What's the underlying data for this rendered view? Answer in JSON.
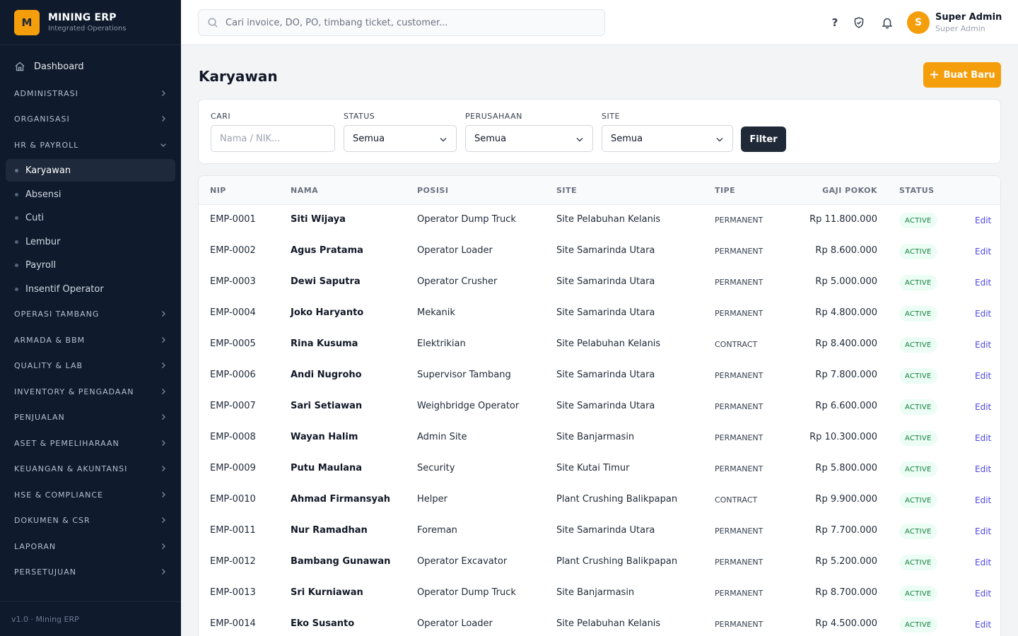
{
  "brand": {
    "logo_letter": "M",
    "name": "MINING ERP",
    "subtitle": "Integrated Operations"
  },
  "sidebar": {
    "dashboard_label": "Dashboard",
    "sections": [
      {
        "label": "ADMINISTRASI",
        "expanded": false
      },
      {
        "label": "ORGANISASI",
        "expanded": false
      },
      {
        "label": "HR & PAYROLL",
        "expanded": true
      },
      {
        "label": "OPERASI TAMBANG",
        "expanded": false
      },
      {
        "label": "ARMADA & BBM",
        "expanded": false
      },
      {
        "label": "QUALITY & LAB",
        "expanded": false
      },
      {
        "label": "INVENTORY & PENGADAAN",
        "expanded": false
      },
      {
        "label": "PENJUALAN",
        "expanded": false
      },
      {
        "label": "ASET & PEMELIHARAAN",
        "expanded": false
      },
      {
        "label": "KEUANGAN & AKUNTANSI",
        "expanded": false
      },
      {
        "label": "HSE & COMPLIANCE",
        "expanded": false
      },
      {
        "label": "DOKUMEN & CSR",
        "expanded": false
      },
      {
        "label": "LAPORAN",
        "expanded": false
      },
      {
        "label": "PERSETUJUAN",
        "expanded": false
      }
    ],
    "hr_items": [
      {
        "label": "Karyawan",
        "active": true
      },
      {
        "label": "Absensi",
        "active": false
      },
      {
        "label": "Cuti",
        "active": false
      },
      {
        "label": "Lembur",
        "active": false
      },
      {
        "label": "Payroll",
        "active": false
      },
      {
        "label": "Insentif Operator",
        "active": false
      }
    ],
    "footer": "v1.0 · Mining ERP"
  },
  "topbar": {
    "search_placeholder": "Cari invoice, DO, PO, timbang ticket, customer...",
    "help_glyph": "?",
    "user": {
      "initial": "S",
      "name": "Super Admin",
      "role": "Super Admin"
    }
  },
  "page": {
    "title": "Karyawan",
    "new_button": "Buat Baru",
    "new_button_glyph": "+"
  },
  "filters": {
    "search": {
      "label": "CARI",
      "placeholder": "Nama / NIK..."
    },
    "status": {
      "label": "STATUS",
      "value": "Semua"
    },
    "company": {
      "label": "PERUSAHAAN",
      "value": "Semua"
    },
    "site": {
      "label": "SITE",
      "value": "Semua"
    },
    "submit": "Filter"
  },
  "table": {
    "columns": {
      "nip": "NIP",
      "nama": "NAMA",
      "posisi": "POSISI",
      "site": "SITE",
      "tipe": "TIPE",
      "gaji": "GAJI POKOK",
      "status": "STATUS"
    },
    "edit_label": "Edit",
    "rows": [
      {
        "nip": "EMP-0001",
        "nama": "Siti Wijaya",
        "posisi": "Operator Dump Truck",
        "site": "Site Pelabuhan Kelanis",
        "tipe": "PERMANENT",
        "gaji": "Rp 11.800.000",
        "status": "ACTIVE"
      },
      {
        "nip": "EMP-0002",
        "nama": "Agus Pratama",
        "posisi": "Operator Loader",
        "site": "Site Samarinda Utara",
        "tipe": "PERMANENT",
        "gaji": "Rp 8.600.000",
        "status": "ACTIVE"
      },
      {
        "nip": "EMP-0003",
        "nama": "Dewi Saputra",
        "posisi": "Operator Crusher",
        "site": "Site Samarinda Utara",
        "tipe": "PERMANENT",
        "gaji": "Rp 5.000.000",
        "status": "ACTIVE"
      },
      {
        "nip": "EMP-0004",
        "nama": "Joko Haryanto",
        "posisi": "Mekanik",
        "site": "Site Samarinda Utara",
        "tipe": "PERMANENT",
        "gaji": "Rp 4.800.000",
        "status": "ACTIVE"
      },
      {
        "nip": "EMP-0005",
        "nama": "Rina Kusuma",
        "posisi": "Elektrikian",
        "site": "Site Pelabuhan Kelanis",
        "tipe": "CONTRACT",
        "gaji": "Rp 8.400.000",
        "status": "ACTIVE"
      },
      {
        "nip": "EMP-0006",
        "nama": "Andi Nugroho",
        "posisi": "Supervisor Tambang",
        "site": "Site Samarinda Utara",
        "tipe": "PERMANENT",
        "gaji": "Rp 7.800.000",
        "status": "ACTIVE"
      },
      {
        "nip": "EMP-0007",
        "nama": "Sari Setiawan",
        "posisi": "Weighbridge Operator",
        "site": "Site Samarinda Utara",
        "tipe": "PERMANENT",
        "gaji": "Rp 6.600.000",
        "status": "ACTIVE"
      },
      {
        "nip": "EMP-0008",
        "nama": "Wayan Halim",
        "posisi": "Admin Site",
        "site": "Site Banjarmasin",
        "tipe": "PERMANENT",
        "gaji": "Rp 10.300.000",
        "status": "ACTIVE"
      },
      {
        "nip": "EMP-0009",
        "nama": "Putu Maulana",
        "posisi": "Security",
        "site": "Site Kutai Timur",
        "tipe": "PERMANENT",
        "gaji": "Rp 5.800.000",
        "status": "ACTIVE"
      },
      {
        "nip": "EMP-0010",
        "nama": "Ahmad Firmansyah",
        "posisi": "Helper",
        "site": "Plant Crushing Balikpapan",
        "tipe": "CONTRACT",
        "gaji": "Rp 9.900.000",
        "status": "ACTIVE"
      },
      {
        "nip": "EMP-0011",
        "nama": "Nur Ramadhan",
        "posisi": "Foreman",
        "site": "Site Samarinda Utara",
        "tipe": "PERMANENT",
        "gaji": "Rp 7.700.000",
        "status": "ACTIVE"
      },
      {
        "nip": "EMP-0012",
        "nama": "Bambang Gunawan",
        "posisi": "Operator Excavator",
        "site": "Plant Crushing Balikpapan",
        "tipe": "PERMANENT",
        "gaji": "Rp 5.200.000",
        "status": "ACTIVE"
      },
      {
        "nip": "EMP-0013",
        "nama": "Sri Kurniawan",
        "posisi": "Operator Dump Truck",
        "site": "Site Banjarmasin",
        "tipe": "PERMANENT",
        "gaji": "Rp 8.700.000",
        "status": "ACTIVE"
      },
      {
        "nip": "EMP-0014",
        "nama": "Eko Susanto",
        "posisi": "Operator Loader",
        "site": "Site Pelabuhan Kelanis",
        "tipe": "PERMANENT",
        "gaji": "Rp 4.500.000",
        "status": "ACTIVE"
      }
    ]
  },
  "colors": {
    "accent": "#f59e0b",
    "sidebar_bg": "#0f1b2d",
    "status_active": "#15803d",
    "link": "#4f46e5"
  },
  "icons": {
    "dashboard": "home-icon",
    "search": "search-icon",
    "help": "help-icon",
    "shield": "shield-check-icon",
    "bell": "bell-icon",
    "chevron": "chevron-right-icon",
    "select": "chevron-down-icon",
    "add": "plus-icon"
  }
}
